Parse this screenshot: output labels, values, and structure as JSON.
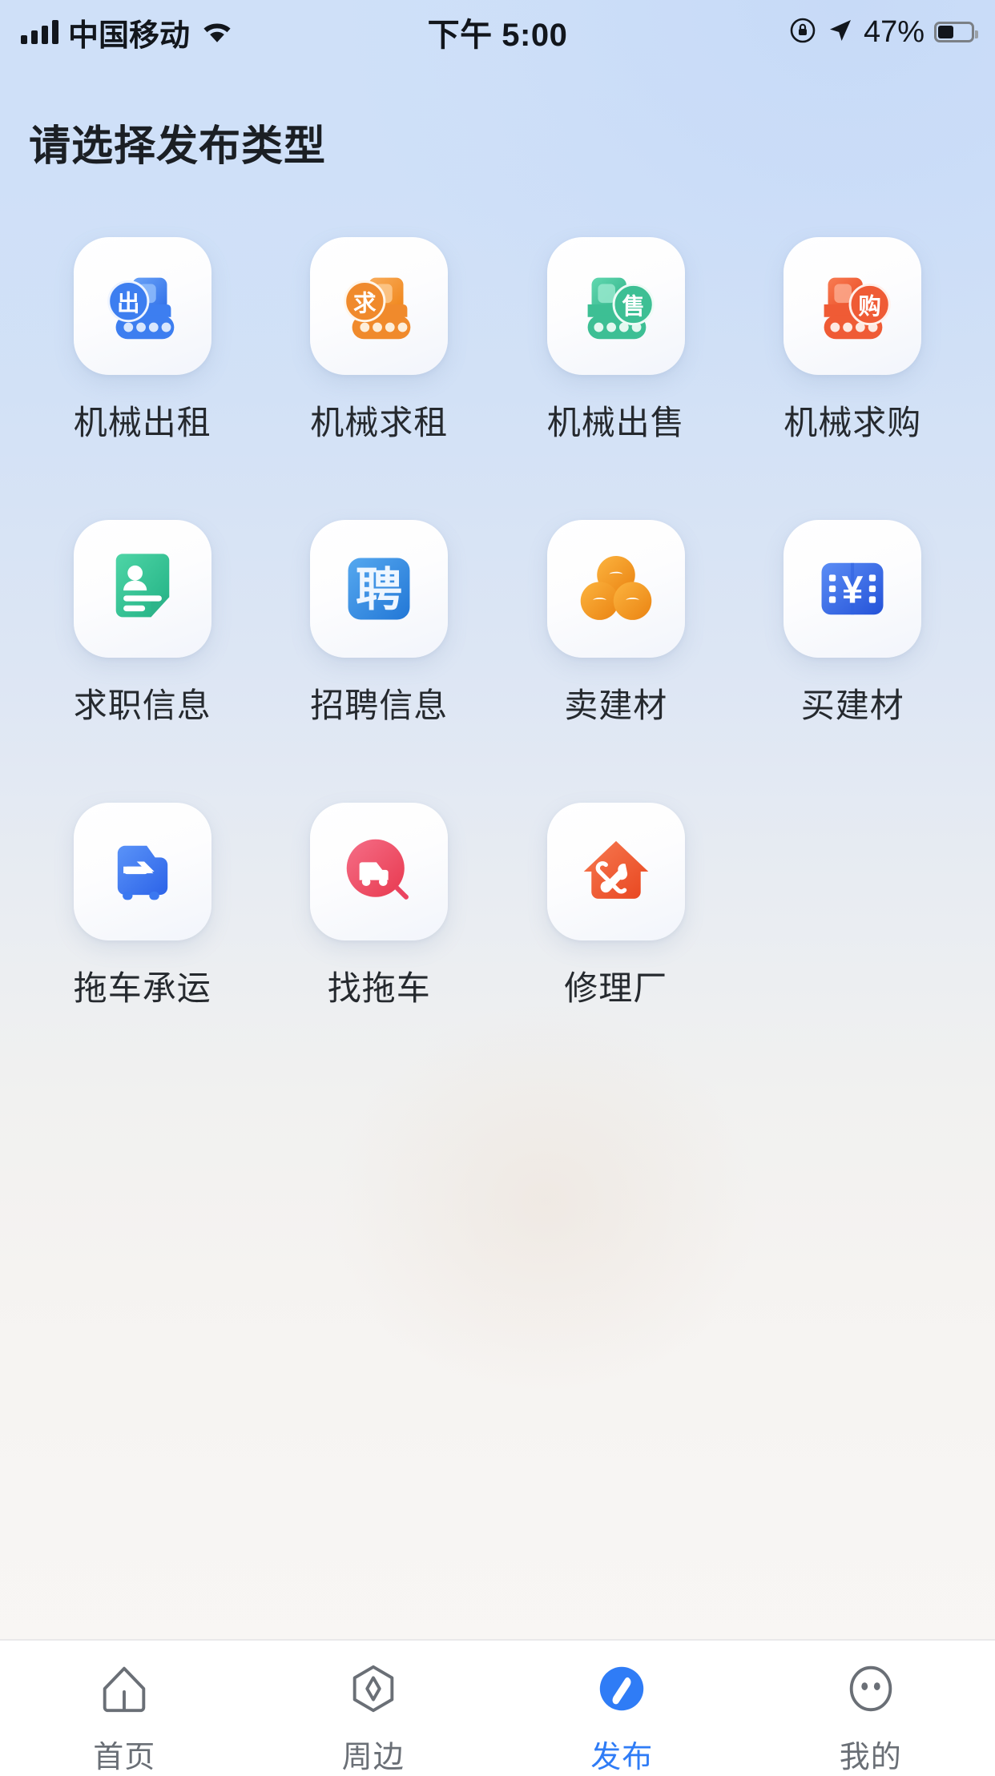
{
  "status_bar": {
    "carrier": "中国移动",
    "signal_icon": "signal-bars-icon",
    "wifi_icon": "wifi-icon",
    "time": "下午 5:00",
    "rotation_lock_icon": "rotation-lock-icon",
    "location_icon": "location-arrow-icon",
    "battery_percent": "47%",
    "battery_icon": "battery-icon"
  },
  "header": {
    "title": "请选择发布类型"
  },
  "grid": {
    "items": [
      {
        "label": "机械出租",
        "icon": "machine-rent-out-icon",
        "badge": "出",
        "color": "#3d7ef0"
      },
      {
        "label": "机械求租",
        "icon": "machine-rent-seek-icon",
        "badge": "求",
        "color": "#f08a2c"
      },
      {
        "label": "机械出售",
        "icon": "machine-sell-icon",
        "badge": "售",
        "color": "#3dbf94"
      },
      {
        "label": "机械求购",
        "icon": "machine-buy-icon",
        "badge": "购",
        "color": "#ef5b35"
      },
      {
        "label": "求职信息",
        "icon": "resume-card-icon",
        "badge": "",
        "color": "#31bf93"
      },
      {
        "label": "招聘信息",
        "icon": "hiring-pin-icon",
        "badge": "聘",
        "color": "#2f8de0"
      },
      {
        "label": "卖建材",
        "icon": "pipes-stack-icon",
        "badge": "",
        "color": "#f2941f"
      },
      {
        "label": "买建材",
        "icon": "yuan-voucher-icon",
        "badge": "¥",
        "color": "#2f63e0"
      },
      {
        "label": "拖车承运",
        "icon": "tow-truck-icon",
        "badge": "",
        "color": "#3b78f0"
      },
      {
        "label": "找拖车",
        "icon": "find-tow-truck-icon",
        "badge": "",
        "color": "#ef4f68"
      },
      {
        "label": "修理厂",
        "icon": "repair-shop-house-icon",
        "badge": "",
        "color": "#ef5b35"
      }
    ]
  },
  "tabbar": {
    "active_color": "#2f7cf6",
    "tabs": [
      {
        "label": "首页",
        "icon": "home-icon",
        "active": false
      },
      {
        "label": "周边",
        "icon": "compass-icon",
        "active": false
      },
      {
        "label": "发布",
        "icon": "publish-pen-icon",
        "active": true
      },
      {
        "label": "我的",
        "icon": "profile-face-icon",
        "active": false
      }
    ]
  }
}
